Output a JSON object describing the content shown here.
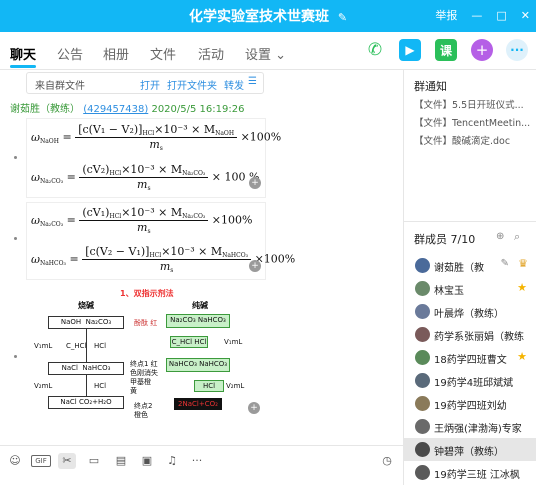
{
  "window": {
    "title": "化学实验室技术世赛班",
    "report": "举报",
    "controls": [
      "—",
      "□",
      "✕"
    ]
  },
  "tabs": [
    {
      "label": "聊天",
      "active": true
    },
    {
      "label": "公告"
    },
    {
      "label": "相册"
    },
    {
      "label": "文件"
    },
    {
      "label": "活动"
    },
    {
      "label": "设置 ⌄"
    }
  ],
  "toolbar": {
    "voice": "phone-icon",
    "video": "video-icon",
    "course": "课",
    "add": "+",
    "more": "···"
  },
  "file_card": {
    "name": "来自群文件",
    "open": "打开",
    "open_folder": "打开文件夹",
    "forward": "转发",
    "menu": "☰"
  },
  "message": {
    "sender": "谢茹胜（教练）",
    "qq": "(429457438)",
    "time": "2020/5/5 16:19:26"
  },
  "formulas": {
    "f1_lhs": "ω",
    "f1_lhs_sub": "NaOH",
    "f1_num": "[c(V₁ − V₂)]",
    "f1_num_sub": "HCl",
    "f1_num_rest": "×10⁻³ × M",
    "f1_num_rest_sub": "NaOH",
    "f1_den": "m",
    "f1_den_sub": "s",
    "f1_tail": "×100%",
    "f2_lhs": "ω",
    "f2_lhs_sub": "Na₂CO₃",
    "f2_num": "(cV₂)",
    "f2_num_sub": "HCl",
    "f2_num_rest": "×10⁻³ × M",
    "f2_num_rest_sub": "Na₂CO₃",
    "f2_den": "m",
    "f2_den_sub": "s",
    "f2_tail": "× 100 %",
    "f3_lhs": "ω",
    "f3_lhs_sub": "Na₂CO₃",
    "f3_num": "(cV₁)",
    "f3_num_sub": "HCl",
    "f3_num_rest": "×10⁻³ × M",
    "f3_num_rest_sub": "Na₂CO₃",
    "f3_den": "m",
    "f3_den_sub": "s",
    "f3_tail": "×100%",
    "f4_lhs": "ω",
    "f4_lhs_sub": "NaHCO₃",
    "f4_num": "[c(V₂ − V₁)]",
    "f4_num_sub": "HCl",
    "f4_num_rest": "×10⁻³ × M",
    "f4_num_rest_sub": "NaHCO₃",
    "f4_den": "m",
    "f4_den_sub": "s",
    "f4_tail": "×100%"
  },
  "diagram": {
    "heading": "1、双指示剂法",
    "left_title": "烧碱",
    "right_title": "纯碱",
    "naoh": "NaOH",
    "na2co3": "Na₂CO₃",
    "nacl": "NaCl",
    "nahco3": "NaHCO₃",
    "nacl_co2": "NaCl   CO₂+H₂O",
    "hcl": "HCl",
    "v1ml": "V₁mL",
    "v2ml": "V₂mL",
    "chcl": "C_HCl",
    "indicator1": "酚酞 红",
    "end1": "终点1 红色刚消失 甲基橙 黄",
    "end2": "终点2 橙色",
    "g_na2co3_nahco3": "Na₂CO₃ NaHCO₃",
    "g_chcl": "C_HCl  HCl",
    "g_v1": "V₁mL",
    "g_nahco3": "NaHCO₃ NaHCO₃",
    "g_hcl": "HCl",
    "g_v2": "V₂mL",
    "red_box": "2NaCl+CO₂"
  },
  "right_panel": {
    "notice_title": "群通知",
    "notices": [
      "【文件】5.5日开班仪式...",
      "【文件】TencentMeetin...",
      "【文件】酸碱滴定.doc"
    ],
    "members_title": "群成员 7/10",
    "members": [
      {
        "name": "谢茹胜（教",
        "avatar": "#4a6a9a"
      },
      {
        "name": "林宝玉",
        "avatar": "#6a8a6a"
      },
      {
        "name": "叶晨烨（教练）",
        "avatar": "#6a7a9a"
      },
      {
        "name": "药学系张丽娟（教练",
        "avatar": "#7a5a5a"
      },
      {
        "name": "18药学四班曹文",
        "avatar": "#5a8a5a"
      },
      {
        "name": "19药学4班邱斌斌",
        "avatar": "#5a6a7a"
      },
      {
        "name": "19药学四班刘幼",
        "avatar": "#8a7a5a"
      },
      {
        "name": "王炳强(津渤海)专家",
        "avatar": "#6a6a6a"
      },
      {
        "name": "钟碧萍（教练）",
        "avatar": "#4a4a4a"
      },
      {
        "name": "19药学三班 江冰枫",
        "avatar": "#5a5a5a"
      }
    ]
  }
}
